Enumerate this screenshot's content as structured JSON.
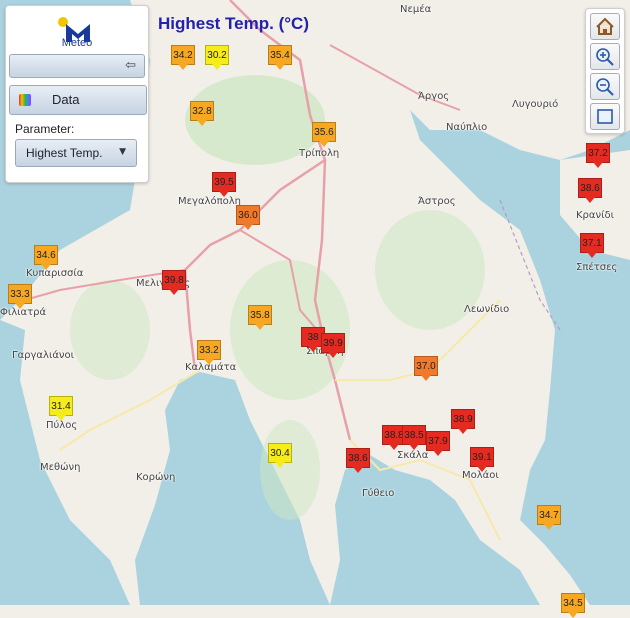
{
  "header": {
    "title": "Highest Temp. (°C)"
  },
  "panel": {
    "logo_text": "Meteo",
    "data_label": "Data",
    "parameter_label": "Parameter:",
    "parameter_value": "Highest Temp."
  },
  "colors": {
    "sea": "#aad3df",
    "land": "#f2efe9",
    "forest": "#cde7c2",
    "road_major": "#e8a0a8",
    "road_minor": "#f7e9a9",
    "yellow": "#f5ec1a",
    "orange": "#f7a822",
    "darkorange": "#f07a2a",
    "red": "#e32b22",
    "title": "#2222aa"
  },
  "places": [
    {
      "name": "Νεμέα"
    },
    {
      "name": "Άργος"
    },
    {
      "name": "Ναύπλιο"
    },
    {
      "name": "Λυγουριό"
    },
    {
      "name": "Τρίπολη"
    },
    {
      "name": "Μεγαλόπολη"
    },
    {
      "name": "Άστρος"
    },
    {
      "name": "Κρανίδι"
    },
    {
      "name": "Σπέτσες"
    },
    {
      "name": "Κυπαρισσία"
    },
    {
      "name": "Μελιγαλάς"
    },
    {
      "name": "Φιλιατρά"
    },
    {
      "name": "Γαργαλιάνοι"
    },
    {
      "name": "Καλαμάτα"
    },
    {
      "name": "Σπάρτη"
    },
    {
      "name": "Λεωνίδιο"
    },
    {
      "name": "Πύλος"
    },
    {
      "name": "Μεθώνη"
    },
    {
      "name": "Κορώνη"
    },
    {
      "name": "Γύθειο"
    },
    {
      "name": "Σκάλα"
    },
    {
      "name": "Μολάοι"
    }
  ],
  "markers": [
    {
      "value": "34.2",
      "level": "orange"
    },
    {
      "value": "30.2",
      "level": "yellow"
    },
    {
      "value": "35.4",
      "level": "orange"
    },
    {
      "value": "32.8",
      "level": "orange"
    },
    {
      "value": "35.6",
      "level": "orange"
    },
    {
      "value": "39.5",
      "level": "red"
    },
    {
      "value": "36.0",
      "level": "darkorange"
    },
    {
      "value": "34.6",
      "level": "orange"
    },
    {
      "value": "33.3",
      "level": "orange"
    },
    {
      "value": "39.8",
      "level": "red"
    },
    {
      "value": "35.8",
      "level": "orange"
    },
    {
      "value": "33.2",
      "level": "orange"
    },
    {
      "value": "38",
      "level": "red"
    },
    {
      "value": "39.9",
      "level": "red"
    },
    {
      "value": "37.0",
      "level": "darkorange"
    },
    {
      "value": "31.4",
      "level": "yellow"
    },
    {
      "value": "30.4",
      "level": "yellow"
    },
    {
      "value": "38.8",
      "level": "red"
    },
    {
      "value": "38.6",
      "level": "red"
    },
    {
      "value": "38.5",
      "level": "red"
    },
    {
      "value": "37.9",
      "level": "red"
    },
    {
      "value": "38.9",
      "level": "red"
    },
    {
      "value": "39.1",
      "level": "red"
    },
    {
      "value": "37.2",
      "level": "red"
    },
    {
      "value": "38.6",
      "level": "red"
    },
    {
      "value": "37.1",
      "level": "red"
    },
    {
      "value": "34.7",
      "level": "orange"
    },
    {
      "value": "34.5",
      "level": "orange"
    }
  ]
}
